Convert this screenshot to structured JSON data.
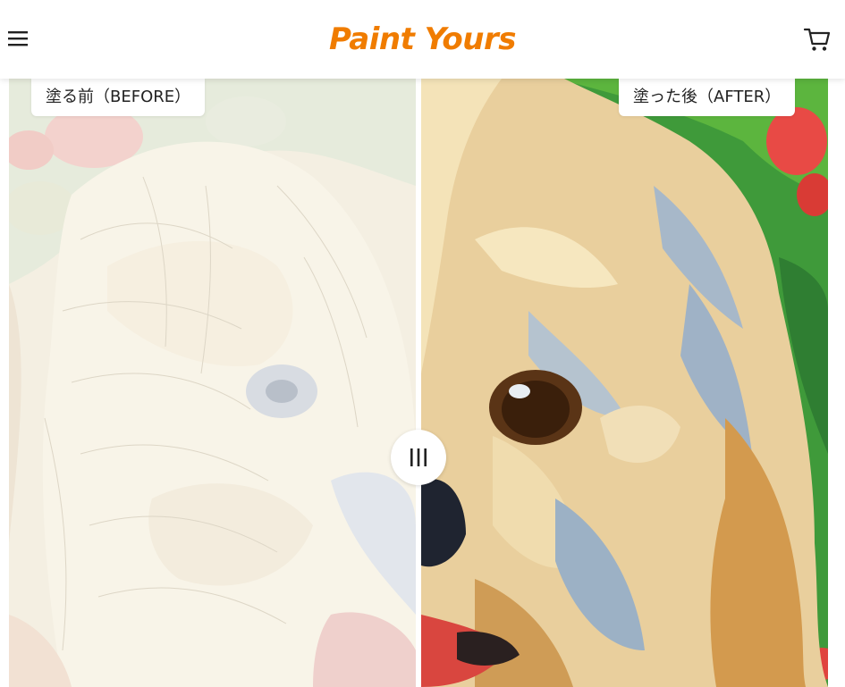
{
  "header": {
    "logo": "Paint Yours",
    "menu_icon": "hamburger-menu-icon",
    "cart_icon": "shopping-cart-icon"
  },
  "comparison": {
    "before_label": "塗る前（BEFORE）",
    "after_label": "塗った後（AFTER）",
    "handle_icon": "drag-handle-icon",
    "slider_position": 0.5
  },
  "colors": {
    "brand": "#f07c00",
    "text": "#222222",
    "before_bg": "#f4efe2",
    "after_green": "#3f9a3a"
  }
}
